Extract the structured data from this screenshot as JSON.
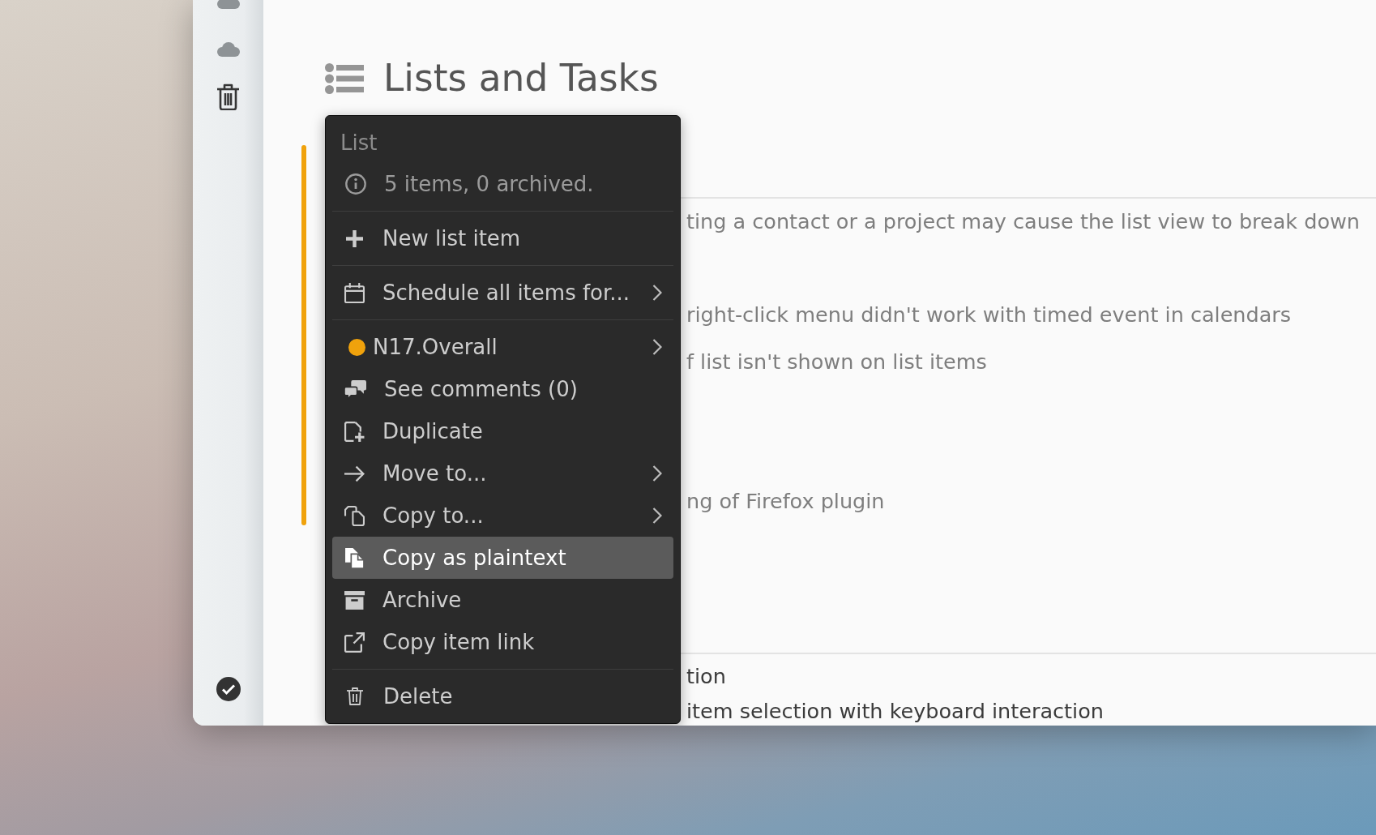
{
  "page": {
    "title": "Lists and Tasks"
  },
  "sections": [
    {
      "selected": true,
      "rows": [
        {
          "text": "ting a contact or a project may cause the list view to break down",
          "done": true
        },
        {
          "text": "right-click menu didn't work with timed event in calendars",
          "done": true
        },
        {
          "text": "f list isn't shown on list items",
          "done": true
        },
        {
          "text": "ng of Firefox plugin",
          "done": true
        }
      ]
    },
    {
      "selected": false,
      "rows": [
        {
          "text": "tion",
          "done": false,
          "children": [
            {
              "text": "item selection with keyboard interaction",
              "done": false
            }
          ]
        }
      ]
    }
  ],
  "context_menu": {
    "title": "List",
    "info": "5 items, 0 archived.",
    "groups": [
      {
        "items": [
          {
            "label": "New list item",
            "kind": "action",
            "submenu": false,
            "selected": false
          }
        ]
      },
      {
        "items": [
          {
            "label": "Schedule all items for...",
            "kind": "action",
            "submenu": true,
            "selected": false
          }
        ]
      },
      {
        "items": [
          {
            "label": "N17.Overall",
            "kind": "list",
            "color": "#f0a20c",
            "submenu": true,
            "selected": false
          },
          {
            "label": "See comments (0)",
            "kind": "action",
            "submenu": false,
            "selected": false
          },
          {
            "label": "Duplicate",
            "kind": "action",
            "submenu": false,
            "selected": false
          },
          {
            "label": "Move to...",
            "kind": "action",
            "submenu": true,
            "selected": false
          },
          {
            "label": "Copy to...",
            "kind": "action",
            "submenu": true,
            "selected": false
          },
          {
            "label": "Copy as plaintext",
            "kind": "action",
            "submenu": false,
            "selected": true
          },
          {
            "label": "Archive",
            "kind": "action",
            "submenu": false,
            "selected": false
          },
          {
            "label": "Copy item link",
            "kind": "action",
            "submenu": false,
            "selected": false
          }
        ]
      },
      {
        "items": [
          {
            "label": "Delete",
            "kind": "action",
            "submenu": false,
            "selected": false
          }
        ]
      }
    ]
  }
}
